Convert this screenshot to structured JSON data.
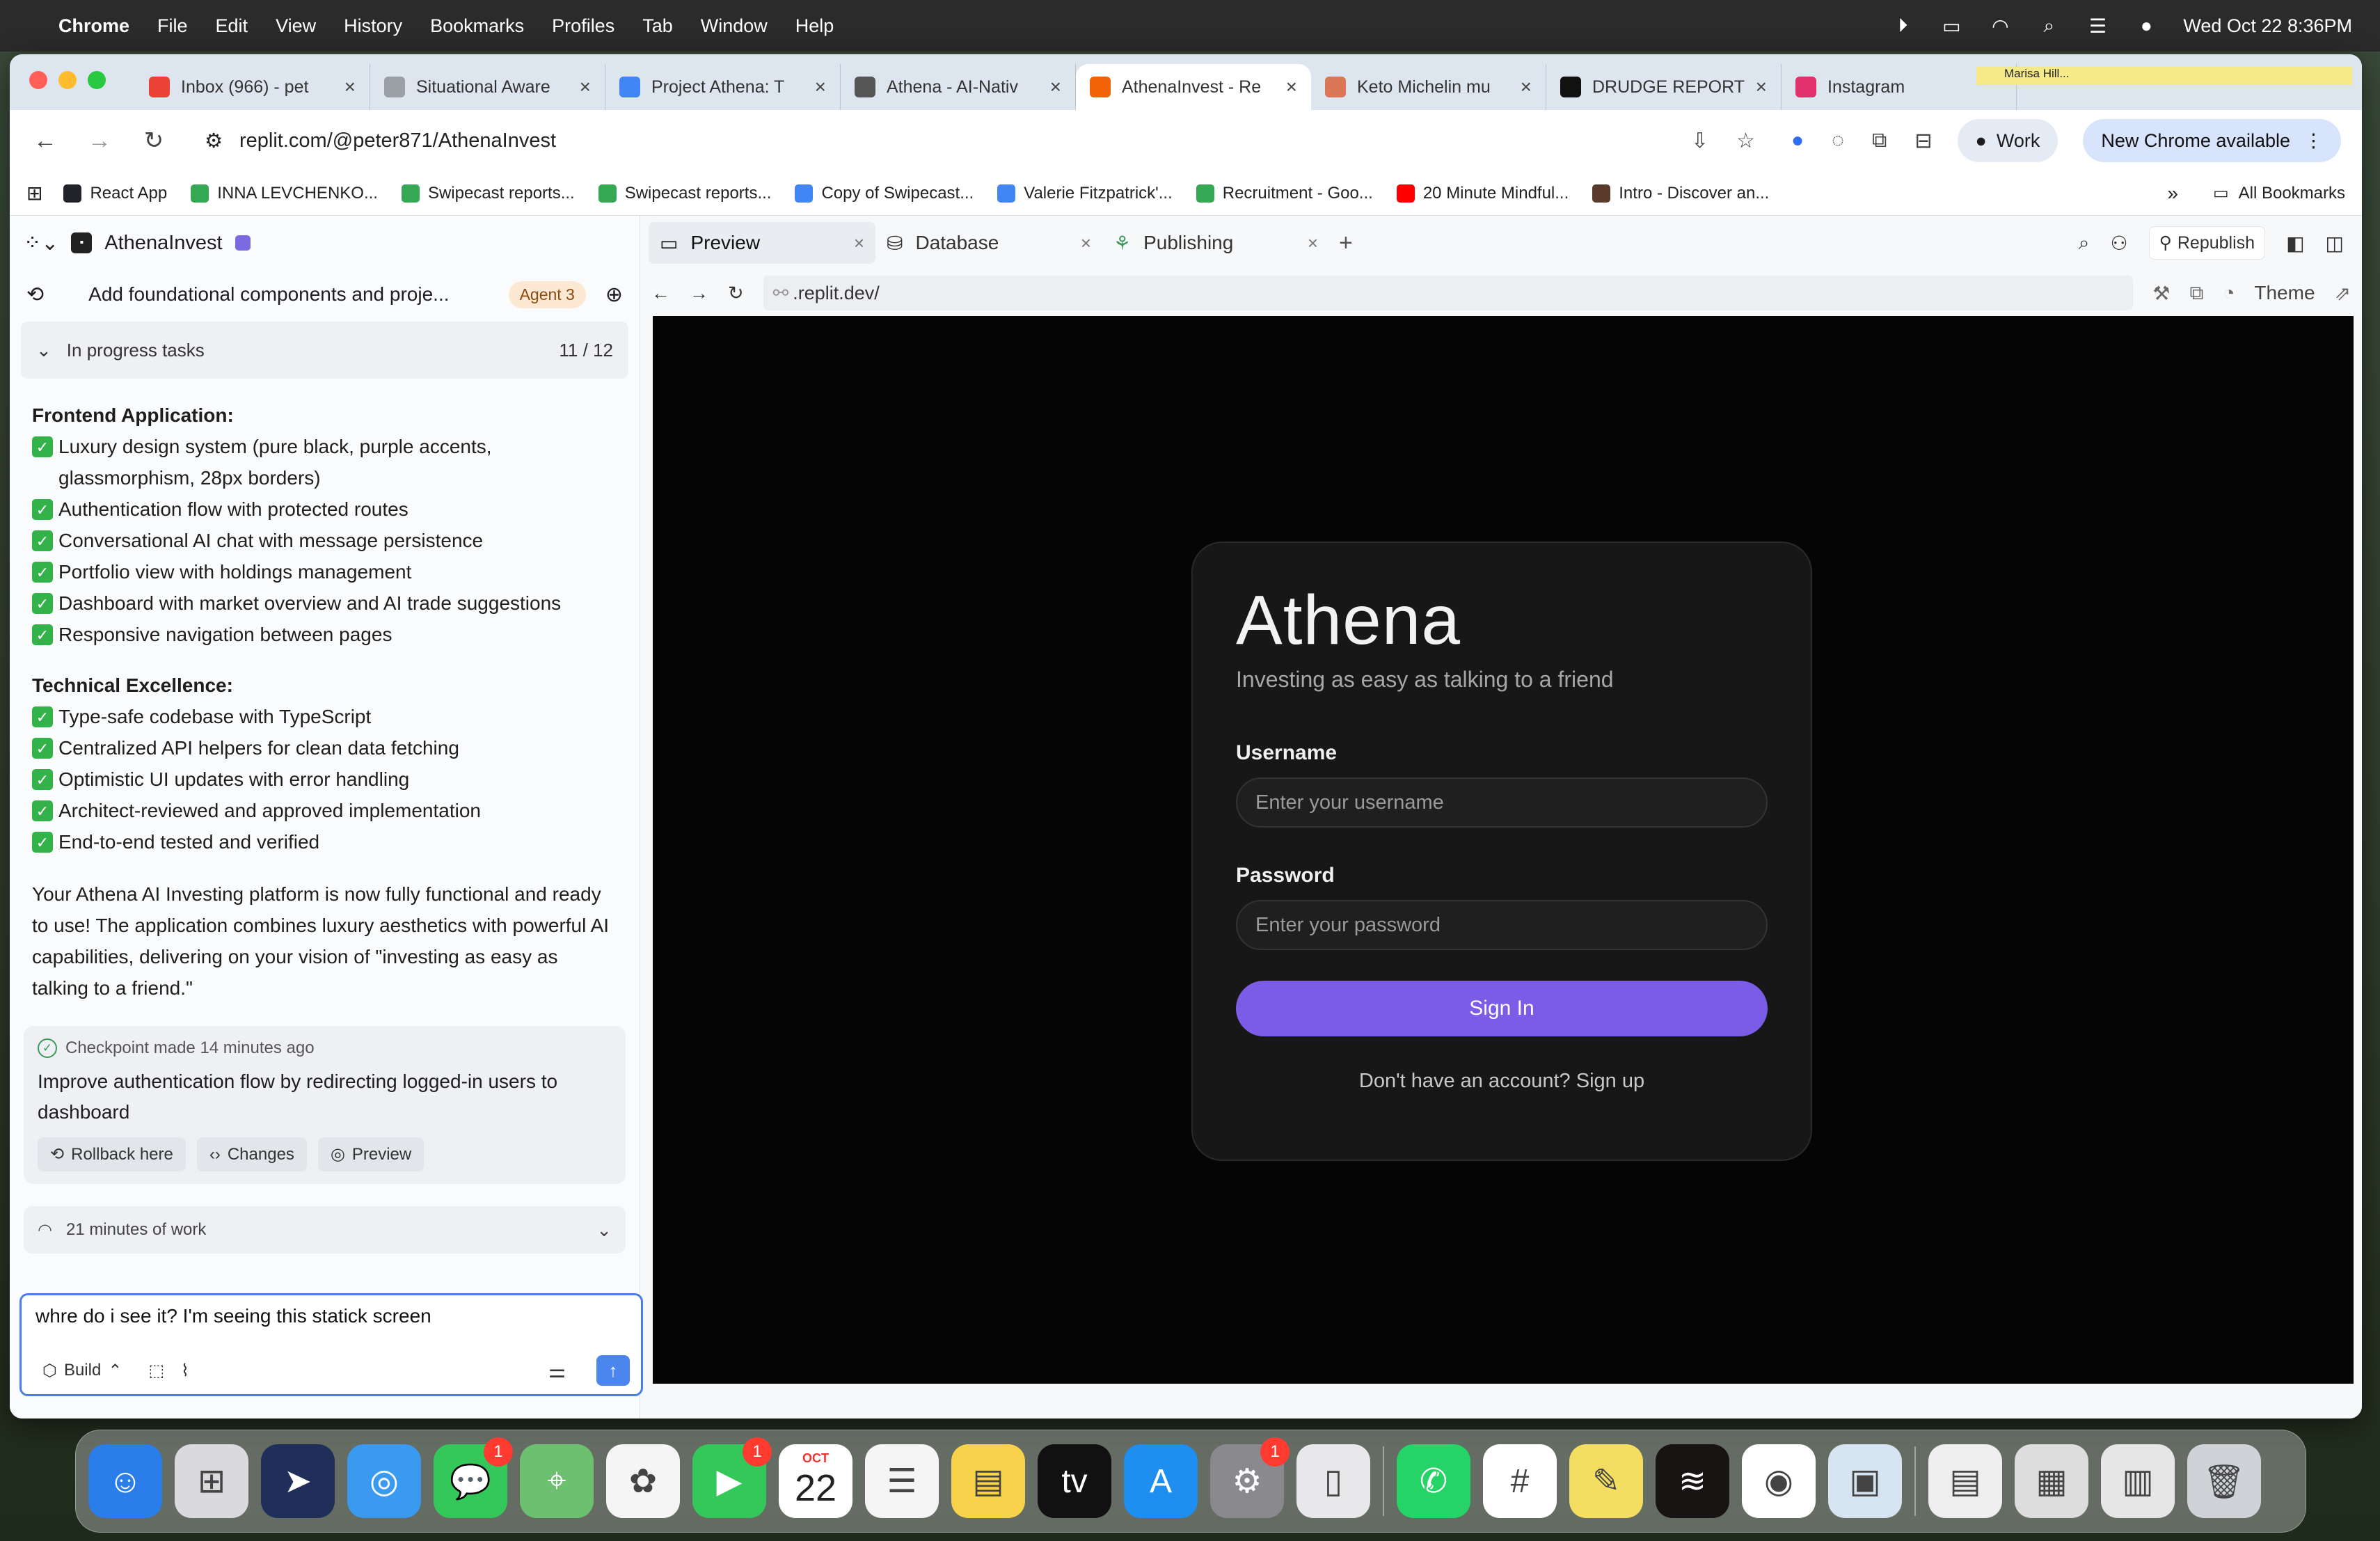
{
  "menubar": {
    "app_name": "Chrome",
    "menus": [
      "File",
      "Edit",
      "View",
      "History",
      "Bookmarks",
      "Profiles",
      "Tab",
      "Window",
      "Help"
    ],
    "datetime": "Wed Oct 22  8:36PM"
  },
  "browser": {
    "tabs": [
      {
        "label": "Inbox (966) - pet",
        "icon": "gmail-icon",
        "color": "#ea4335"
      },
      {
        "label": "Situational Aware",
        "icon": "blank-page-icon",
        "color": "#9aa0a6"
      },
      {
        "label": "Project Athena: T",
        "icon": "docs-icon",
        "color": "#4285f4"
      },
      {
        "label": "Athena - AI-Nativ",
        "icon": "globe-icon",
        "color": "#555555"
      },
      {
        "label": "AthenaInvest - Re",
        "icon": "replit-icon",
        "color": "#f26207",
        "active": true
      },
      {
        "label": "Keto Michelin mu",
        "icon": "claude-icon",
        "color": "#d97757"
      },
      {
        "label": "DRUDGE REPORT",
        "icon": "drudge-icon",
        "color": "#111111"
      },
      {
        "label": "Instagram",
        "icon": "instagram-icon",
        "color": "#e1306c"
      }
    ],
    "ticker_text": "Marisa Hill...",
    "url": "replit.com/@peter871/AthenaInvest",
    "profile_label": "Work",
    "update_label": "New Chrome available",
    "bookmarks": [
      {
        "label": "React App",
        "color": "#20232a"
      },
      {
        "label": "INNA LEVCHENKO...",
        "color": "#34a853"
      },
      {
        "label": "Swipecast reports...",
        "color": "#34a853"
      },
      {
        "label": "Swipecast reports...",
        "color": "#34a853"
      },
      {
        "label": "Copy of Swipecast...",
        "color": "#4285f4"
      },
      {
        "label": "Valerie Fitzpatrick'...",
        "color": "#4285f4"
      },
      {
        "label": "Recruitment - Goo...",
        "color": "#34a853"
      },
      {
        "label": "20 Minute Mindful...",
        "color": "#ff0000"
      },
      {
        "label": "Intro - Discover an...",
        "color": "#5a3a2a"
      }
    ],
    "all_bookmarks_label": "All Bookmarks"
  },
  "replit": {
    "project_name": "AthenaInvest",
    "thread_title": "Add foundational components and proje...",
    "agent_badge": "Agent 3",
    "progress": {
      "label": "In progress tasks",
      "count": "11 / 12"
    },
    "sections": [
      {
        "heading": "Frontend Application:",
        "items": [
          "Luxury design system (pure black, purple accents, glassmorphism, 28px borders)",
          "Authentication flow with protected routes",
          "Conversational AI chat with message persistence",
          "Portfolio view with holdings management",
          "Dashboard with market overview and AI trade suggestions",
          "Responsive navigation between pages"
        ]
      },
      {
        "heading": "Technical Excellence:",
        "items": [
          "Type-safe codebase with TypeScript",
          "Centralized API helpers for clean data fetching",
          "Optimistic UI updates with error handling",
          "Architect-reviewed and approved implementation",
          "End-to-end tested and verified"
        ]
      }
    ],
    "summary": "Your Athena AI Investing platform is now fully functional and ready to use! The application combines luxury aesthetics with powerful AI capabilities, delivering on your vision of \"investing as easy as talking to a friend.\"",
    "checkpoint": {
      "head": "Checkpoint made 14 minutes ago",
      "body": "Improve authentication flow by redirecting logged-in users to dashboard",
      "rollback_label": "Rollback here",
      "changes_label": "Changes",
      "preview_label": "Preview"
    },
    "work_label": "21 minutes of work",
    "composer": {
      "text": "whre do i see it? I'm seeing this statick screen",
      "mode_label": "Build"
    },
    "preview_tabs": [
      {
        "label": "Preview",
        "icon": "monitor-icon"
      },
      {
        "label": "Database",
        "icon": "database-icon"
      },
      {
        "label": "Publishing",
        "icon": "publishing-icon"
      }
    ],
    "republish_label": "Republish",
    "preview_url": ".replit.dev/",
    "theme_label": "Theme"
  },
  "login": {
    "brand": "Athena",
    "tagline": "Investing as easy as talking to a friend",
    "username_label": "Username",
    "username_placeholder": "Enter your username",
    "password_label": "Password",
    "password_placeholder": "Enter your password",
    "signin_label": "Sign In",
    "signup_text": "Don't have an account? Sign up"
  },
  "dock": {
    "apps": [
      {
        "name": "finder-icon",
        "color": "#2b7de9"
      },
      {
        "name": "launchpad-icon",
        "color": "#d9d9de"
      },
      {
        "name": "direct-mail-icon",
        "color": "#1f2f5a"
      },
      {
        "name": "safari-icon",
        "color": "#3a9af0"
      },
      {
        "name": "messages-icon",
        "color": "#34c759",
        "badge": "1"
      },
      {
        "name": "maps-icon",
        "color": "#6cc070"
      },
      {
        "name": "photos-icon",
        "color": "#f5f5f5"
      },
      {
        "name": "facetime-icon",
        "color": "#34c759",
        "badge": "1"
      },
      {
        "name": "calendar-icon",
        "color": "#ffffff",
        "month": "OCT",
        "day": "22"
      },
      {
        "name": "reminders-icon",
        "color": "#f5f5f5"
      },
      {
        "name": "notes-icon",
        "color": "#f7d24a"
      },
      {
        "name": "apple-tv-icon",
        "color": "#111111"
      },
      {
        "name": "app-store-icon",
        "color": "#1e8ff0"
      },
      {
        "name": "system-settings-icon",
        "color": "#8a8a8e",
        "badge": "1"
      },
      {
        "name": "iphone-mirroring-icon",
        "color": "#e8e8ea"
      },
      {
        "name": "whatsapp-icon",
        "color": "#25d366"
      },
      {
        "name": "slack-icon",
        "color": "#ffffff"
      },
      {
        "name": "stickies-icon",
        "color": "#f3de62"
      },
      {
        "name": "spotify-icon",
        "color": "#191414"
      },
      {
        "name": "chrome-icon",
        "color": "#ffffff"
      },
      {
        "name": "preview-icon",
        "color": "#d6e4f2"
      },
      {
        "name": "document-stack-icon",
        "color": "#eeeeee"
      },
      {
        "name": "screenshot-folder-icon",
        "color": "#dddddd"
      },
      {
        "name": "downloads-stack-icon",
        "color": "#e6e6e6"
      },
      {
        "name": "trash-icon",
        "color": "#cfd3d8"
      }
    ]
  }
}
